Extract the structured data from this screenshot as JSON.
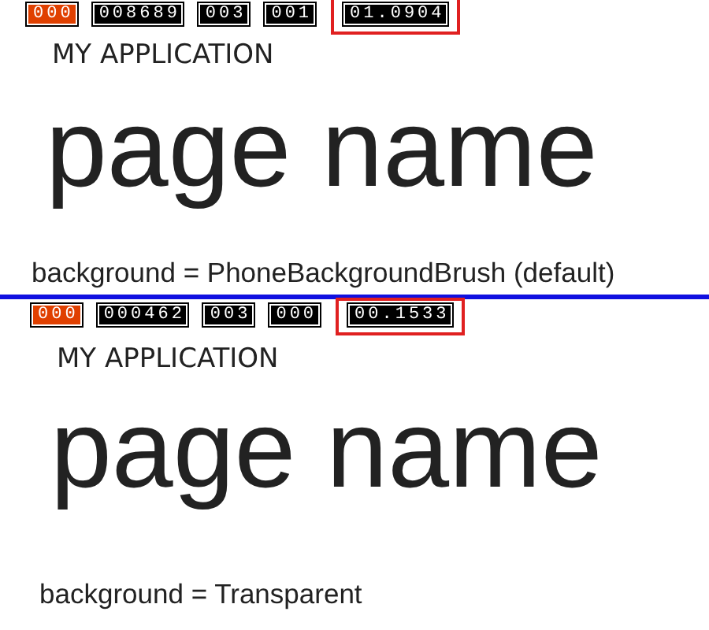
{
  "panels": [
    {
      "counters": [
        {
          "value": "000",
          "color": "#e04000",
          "highlighted": false
        },
        {
          "value": "008689",
          "color": "#000000",
          "highlighted": false
        },
        {
          "value": "003",
          "color": "#000000",
          "highlighted": false
        },
        {
          "value": "001",
          "color": "#000000",
          "highlighted": false
        },
        {
          "value": "01.0904",
          "color": "#000000",
          "highlighted": true
        }
      ],
      "app_title": "MY APPLICATION",
      "page_title": "page name",
      "caption": "background = PhoneBackgroundBrush (default)"
    },
    {
      "counters": [
        {
          "value": "000",
          "color": "#e04000",
          "highlighted": false
        },
        {
          "value": "000462",
          "color": "#000000",
          "highlighted": false
        },
        {
          "value": "003",
          "color": "#000000",
          "highlighted": false
        },
        {
          "value": "000",
          "color": "#000000",
          "highlighted": false
        },
        {
          "value": "00.1533",
          "color": "#000000",
          "highlighted": true
        }
      ],
      "app_title": "MY APPLICATION",
      "page_title": "page name",
      "caption": "background = Transparent"
    }
  ]
}
